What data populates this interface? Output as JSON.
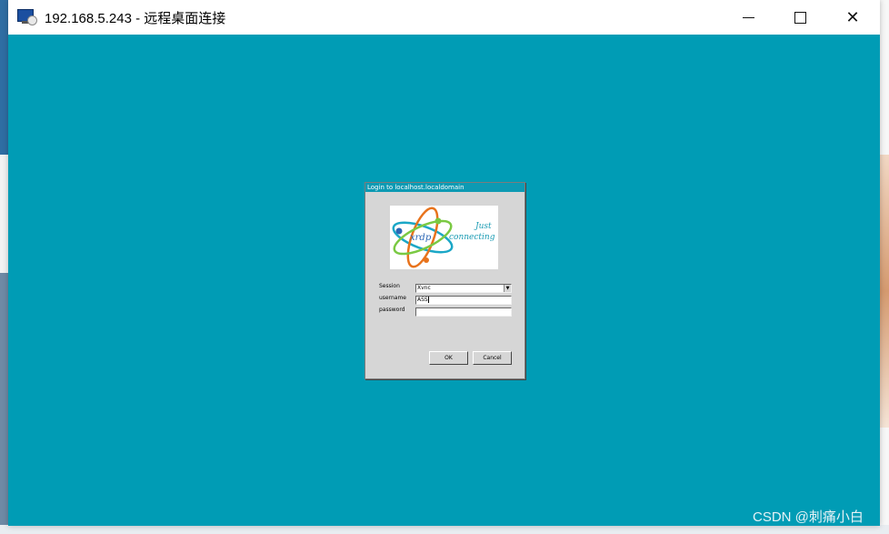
{
  "window": {
    "title": "192.168.5.243 - 远程桌面连接",
    "icon": "remote-desktop-icon",
    "controls": {
      "minimize": "minimize-icon",
      "maximize": "maximize-icon",
      "close": "close-icon"
    },
    "desktop_color": "#009cb5"
  },
  "dialog": {
    "title": "Login to localhost.localdomain",
    "logo": {
      "text_1": "Just",
      "text_2": "connecting",
      "brand": "xrdp"
    },
    "fields": {
      "session_label": "Session",
      "session_value": "Xvnc",
      "username_label": "username",
      "username_value": "ASS",
      "password_label": "password",
      "password_value": ""
    },
    "buttons": {
      "ok": "OK",
      "cancel": "Cancel"
    },
    "title_color": "#0d9ab3"
  },
  "watermark": "CSDN @刺痛小白"
}
